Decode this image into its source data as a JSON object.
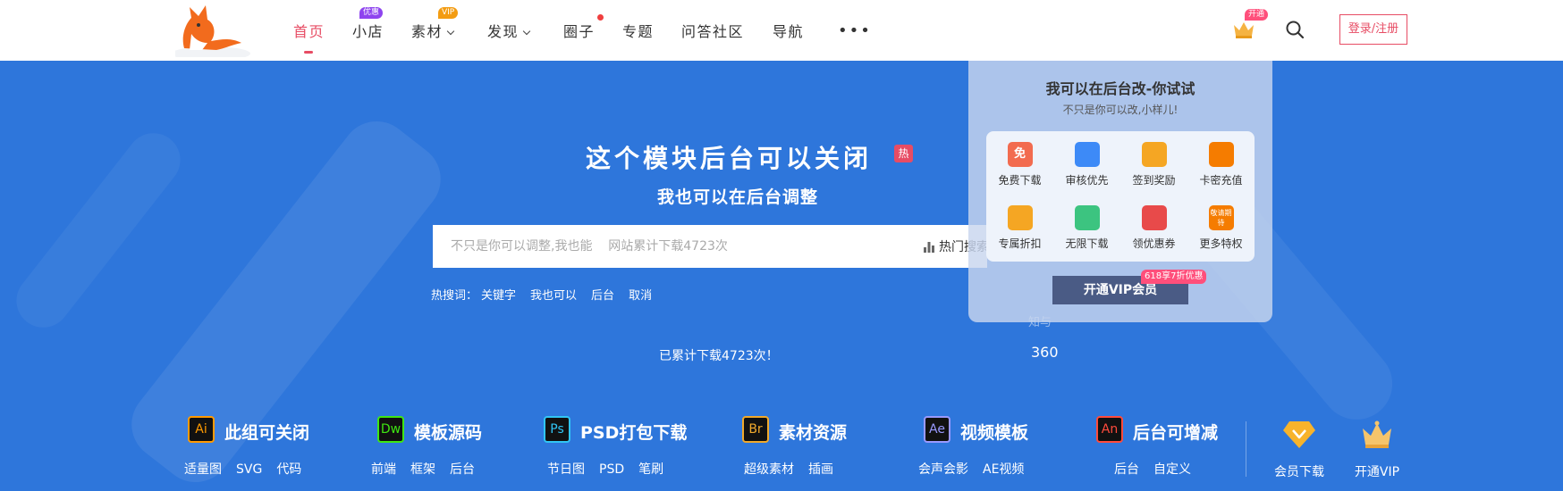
{
  "header": {
    "nav": [
      {
        "label": "首页",
        "active": true
      },
      {
        "label": "小店",
        "badge": "优惠"
      },
      {
        "label": "素材",
        "badge": "VIP",
        "dropdown": true
      },
      {
        "label": "发现",
        "dropdown": true
      },
      {
        "label": "圈子",
        "dot": true
      },
      {
        "label": "专题"
      },
      {
        "label": "问答社区"
      },
      {
        "label": "导航"
      }
    ],
    "more_label": "•••",
    "crown_badge": "开通",
    "login_label": "登录/注册"
  },
  "hero": {
    "title": "这个模块后台可以关闭",
    "hot_tag": "热",
    "subtitle": "我也可以在后台调整",
    "search_placeholder": "不只是你可以调整,我也能    网站累计下载4723次",
    "hot_button": "热门搜索",
    "hotwords_label": "热搜词：",
    "hotwords": [
      "关键字",
      "我也可以",
      "后台",
      "取消"
    ],
    "total_downloads": "已累计下载4723次！",
    "number": "360",
    "faint": "知与"
  },
  "vip_popup": {
    "title": "我可以在后台改-你试试",
    "subtitle": "不只是你可以改,小样儿!",
    "perks": [
      {
        "label": "免费下载",
        "icon": "free-download-icon",
        "color": "#f26b4f"
      },
      {
        "label": "审核优先",
        "icon": "review-priority-icon",
        "color": "#3d8af7"
      },
      {
        "label": "签到奖励",
        "icon": "checkin-reward-icon",
        "color": "#f5a623"
      },
      {
        "label": "卡密充值",
        "icon": "card-recharge-icon",
        "color": "#f57c00"
      },
      {
        "label": "专属折扣",
        "icon": "discount-tag-icon",
        "color": "#f5a623"
      },
      {
        "label": "无限下载",
        "icon": "unlimited-download-icon",
        "color": "#3cc480"
      },
      {
        "label": "领优惠券",
        "icon": "coupon-icon",
        "color": "#e84a4a"
      },
      {
        "label": "更多特权",
        "icon": "more-privilege-icon",
        "color": "#f57c00"
      }
    ],
    "more_icon_text": "敬请期待",
    "free_icon_text": "免",
    "open_vip": "开通VIP会员",
    "promo": "618享7折优惠"
  },
  "categories": [
    {
      "icon": "Ai",
      "title": "此组可关闭",
      "color": "#ff9a00",
      "links": [
        "适量图",
        "SVG",
        "代码"
      ]
    },
    {
      "icon": "Dw",
      "title": "模板源码",
      "color": "#3fe612",
      "links": [
        "前端",
        "框架",
        "后台"
      ]
    },
    {
      "icon": "Ps",
      "title": "PSD打包下载",
      "color": "#31c5f4",
      "links": [
        "节日图",
        "PSD",
        "笔刷"
      ]
    },
    {
      "icon": "Br",
      "title": "素材资源",
      "color": "#f0a92c",
      "links": [
        "超级素材",
        "插画"
      ]
    },
    {
      "icon": "Ae",
      "title": "视频模板",
      "color": "#9999ff",
      "links": [
        "会声会影",
        "AE视频"
      ]
    },
    {
      "icon": "An",
      "title": "后台可增减",
      "color": "#ff4b3c",
      "links": [
        "后台",
        "自定义"
      ]
    }
  ],
  "side_links": [
    {
      "label": "会员下载",
      "icon": "diamond-icon"
    },
    {
      "label": "开通VIP",
      "icon": "crown-icon"
    }
  ]
}
